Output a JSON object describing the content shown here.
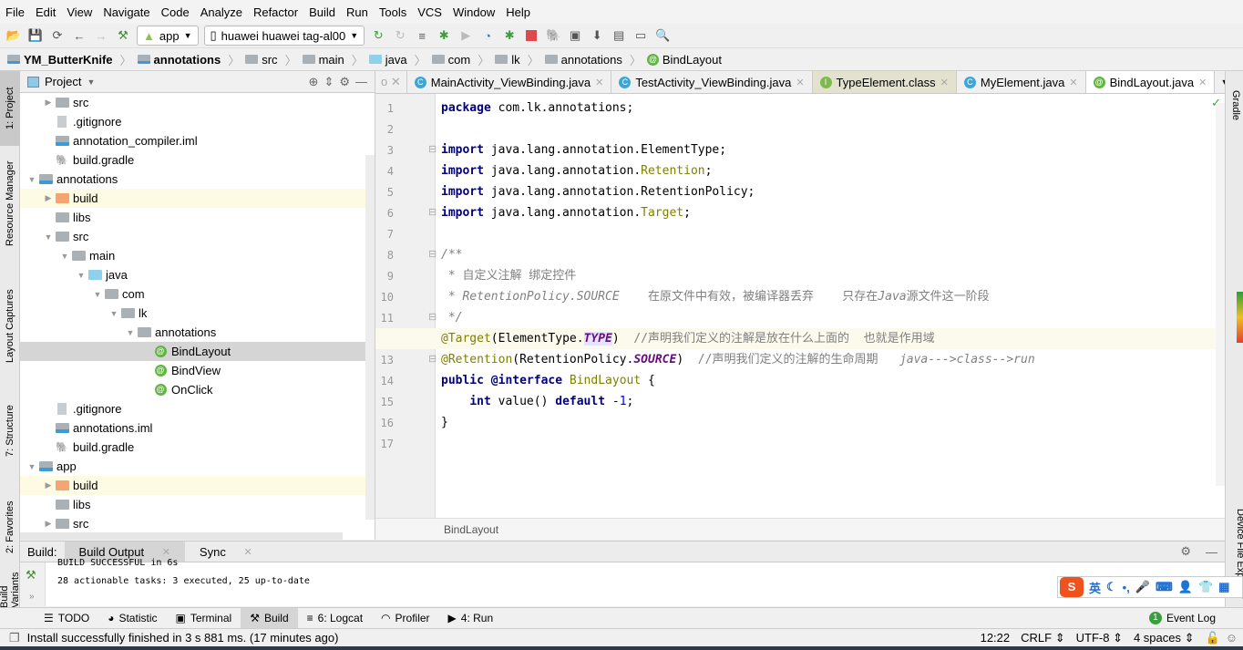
{
  "menu": [
    "File",
    "Edit",
    "View",
    "Navigate",
    "Code",
    "Analyze",
    "Refactor",
    "Build",
    "Run",
    "Tools",
    "VCS",
    "Window",
    "Help"
  ],
  "toolbar": {
    "run_config": "app",
    "device": "huawei huawei tag-al00"
  },
  "breadcrumb": [
    "YM_ButterKnife",
    "annotations",
    "src",
    "main",
    "java",
    "com",
    "lk",
    "annotations",
    "BindLayout"
  ],
  "left_strip": [
    "1: Project",
    "Resource Manager",
    "Layout Captures",
    "7: Structure",
    "2: Favorites",
    "Build Variants"
  ],
  "right_strip": [
    "Gradle",
    "Device File Explorer"
  ],
  "project": {
    "title": "Project",
    "tree": [
      {
        "label": "src",
        "level": 2,
        "arrow": "right",
        "icon": "folder"
      },
      {
        "label": ".gitignore",
        "level": 2,
        "arrow": "",
        "icon": "file"
      },
      {
        "label": "annotation_compiler.iml",
        "level": 2,
        "arrow": "",
        "icon": "module"
      },
      {
        "label": "build.gradle",
        "level": 2,
        "arrow": "",
        "icon": "gradle"
      },
      {
        "label": "annotations",
        "level": 1,
        "arrow": "down",
        "icon": "module"
      },
      {
        "label": "build",
        "level": 2,
        "arrow": "right",
        "icon": "folder-orange",
        "state": "highlight"
      },
      {
        "label": "libs",
        "level": 2,
        "arrow": "",
        "icon": "folder"
      },
      {
        "label": "src",
        "level": 2,
        "arrow": "down",
        "icon": "folder"
      },
      {
        "label": "main",
        "level": 3,
        "arrow": "down",
        "icon": "folder"
      },
      {
        "label": "java",
        "level": 4,
        "arrow": "down",
        "icon": "folder-blue"
      },
      {
        "label": "com",
        "level": 5,
        "arrow": "down",
        "icon": "package"
      },
      {
        "label": "lk",
        "level": 6,
        "arrow": "down",
        "icon": "package"
      },
      {
        "label": "annotations",
        "level": 7,
        "arrow": "down",
        "icon": "package"
      },
      {
        "label": "BindLayout",
        "level": 8,
        "arrow": "",
        "icon": "annotation",
        "state": "selected"
      },
      {
        "label": "BindView",
        "level": 8,
        "arrow": "",
        "icon": "annotation"
      },
      {
        "label": "OnClick",
        "level": 8,
        "arrow": "",
        "icon": "annotation"
      },
      {
        "label": ".gitignore",
        "level": 2,
        "arrow": "",
        "icon": "file"
      },
      {
        "label": "annotations.iml",
        "level": 2,
        "arrow": "",
        "icon": "module"
      },
      {
        "label": "build.gradle",
        "level": 2,
        "arrow": "",
        "icon": "gradle"
      },
      {
        "label": "app",
        "level": 1,
        "arrow": "down",
        "icon": "module"
      },
      {
        "label": "build",
        "level": 2,
        "arrow": "right",
        "icon": "folder-orange",
        "state": "highlight"
      },
      {
        "label": "libs",
        "level": 2,
        "arrow": "",
        "icon": "folder"
      },
      {
        "label": "src",
        "level": 2,
        "arrow": "right",
        "icon": "folder"
      }
    ]
  },
  "tabs": [
    {
      "label": "MainActivity_ViewBinding.java",
      "icon": "C",
      "kind": "class"
    },
    {
      "label": "TestActivity_ViewBinding.java",
      "icon": "C",
      "kind": "class"
    },
    {
      "label": "TypeElement.class",
      "icon": "I",
      "kind": "interface"
    },
    {
      "label": "MyElement.java",
      "icon": "C",
      "kind": "class"
    },
    {
      "label": "BindLayout.java",
      "icon": "@",
      "kind": "annotation",
      "active": true
    }
  ],
  "tab_overflow": "5",
  "code": [
    [
      {
        "t": "package",
        "c": "kw"
      },
      {
        "t": " com.lk.annotations;"
      }
    ],
    [],
    [
      {
        "t": "import",
        "c": "kw"
      },
      {
        "t": " java.lang.annotation.ElementType;"
      }
    ],
    [
      {
        "t": "import",
        "c": "kw"
      },
      {
        "t": " java.lang.annotation."
      },
      {
        "t": "Retention",
        "c": "ann"
      },
      {
        "t": ";"
      }
    ],
    [
      {
        "t": "import",
        "c": "kw"
      },
      {
        "t": " java.lang.annotation.RetentionPolicy;"
      }
    ],
    [
      {
        "t": "import",
        "c": "kw"
      },
      {
        "t": " java.lang.annotation."
      },
      {
        "t": "Target",
        "c": "ann"
      },
      {
        "t": ";"
      }
    ],
    [],
    [
      {
        "t": "/**",
        "c": "cmi"
      }
    ],
    [
      {
        "t": " * 自定义注解 绑定控件",
        "c": "cm"
      }
    ],
    [
      {
        "t": " * RetentionPolicy.SOURCE",
        "c": "cmi"
      },
      {
        "t": "    在原文件中有效，被编译器丢弃    只存在",
        "c": "cm"
      },
      {
        "t": "Java",
        "c": "cmi"
      },
      {
        "t": "源文件这一阶段",
        "c": "cm"
      }
    ],
    [
      {
        "t": " */",
        "c": "cmi"
      }
    ],
    [
      {
        "t": "@Target",
        "c": "ann"
      },
      {
        "t": "(ElementType."
      },
      {
        "t": "TYPE",
        "c": "sth"
      },
      {
        "t": ")  "
      },
      {
        "t": "//声明我们定义的注解是放在什么上面的  也就是作用域",
        "c": "cm"
      }
    ],
    [
      {
        "t": "@Retention",
        "c": "ann"
      },
      {
        "t": "(RetentionPolicy."
      },
      {
        "t": "SOURCE",
        "c": "st"
      },
      {
        "t": ")  "
      },
      {
        "t": "//声明我们定义的注解的生命周期   ",
        "c": "cm"
      },
      {
        "t": "java--->class-->run",
        "c": "cmi"
      }
    ],
    [
      {
        "t": "public",
        "c": "kw"
      },
      {
        "t": " "
      },
      {
        "t": "@interface",
        "c": "kw"
      },
      {
        "t": " "
      },
      {
        "t": "BindLayout",
        "c": "ann"
      },
      {
        "t": " {"
      }
    ],
    [
      {
        "t": "    "
      },
      {
        "t": "int",
        "c": "kw"
      },
      {
        "t": " value() "
      },
      {
        "t": "default",
        "c": "kw"
      },
      {
        "t": " -"
      },
      {
        "t": "1",
        "c": "num"
      },
      {
        "t": ";"
      }
    ],
    [
      {
        "t": "}"
      }
    ],
    []
  ],
  "current_line": 12,
  "editor_breadcrumb": "BindLayout",
  "build": {
    "label": "Build:",
    "tabs": [
      "Build Output",
      "Sync"
    ],
    "lines": [
      "BUILD SUCCESSFUL in 6s",
      "28 actionable tasks: 3 executed, 25 up-to-date"
    ]
  },
  "tool_tabs": [
    {
      "label": "TODO",
      "icon": "list-icon"
    },
    {
      "label": "Statistic",
      "icon": "statistic-icon"
    },
    {
      "label": "Terminal",
      "icon": "terminal-icon"
    },
    {
      "label": "Build",
      "icon": "hammer-icon",
      "active": true
    },
    {
      "label": "6: Logcat",
      "icon": "logcat-icon"
    },
    {
      "label": "Profiler",
      "icon": "profiler-icon"
    },
    {
      "label": "4: Run",
      "icon": "run-icon"
    }
  ],
  "event_log": {
    "label": "Event Log",
    "count": "1"
  },
  "status": {
    "message": "Install successfully finished in 3 s 881 ms. (17 minutes ago)",
    "position": "12:22",
    "line_sep": "CRLF",
    "encoding": "UTF-8",
    "indent": "4 spaces"
  },
  "ime": {
    "logo": "S",
    "lang": "英"
  }
}
